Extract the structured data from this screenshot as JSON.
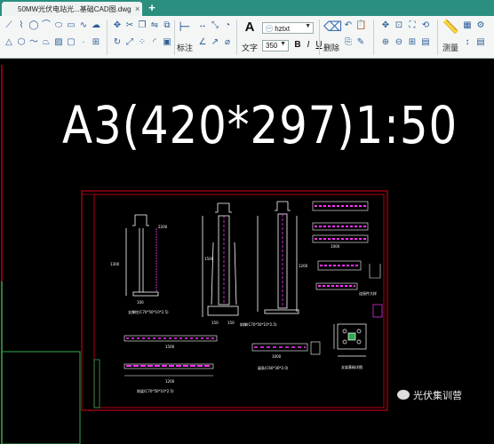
{
  "tab": {
    "title": "50MW光伏电站光...基础CAD图.dwg",
    "close_glyph": "×",
    "add_glyph": "+"
  },
  "ribbon": {
    "dimension_label": "标注",
    "text_label": "文字",
    "delete_label": "删除",
    "measure_label": "测量",
    "font_value": "hztxt",
    "size_value": "350",
    "bold": "B",
    "italic": "I",
    "underline": "U",
    "text_icon": "A"
  },
  "drawing": {
    "scale_title": "A3(420*297)1:50",
    "labels": [
      "支撑柱(C70*50*10*2.5)",
      "斜撑(C70*50*10*2.5)",
      "斜梁(C70*50*10*2.5)",
      "檩条(C60*30*2.0)",
      "支架基础详图",
      "2200",
      "1500",
      "1200",
      "1300",
      "100",
      "150",
      "150",
      "1500",
      "1200",
      "1000",
      "1000",
      "连接件大样"
    ]
  },
  "watermark": "光伏集训营",
  "colors": {
    "tabbar": "#2b8f80",
    "ribbon": "#f4f6f6",
    "canvas": "#000000",
    "frame_red": "#e0001a",
    "magenta": "#ff33ff",
    "green": "#2fa84f",
    "cad_white": "#ffffff"
  }
}
